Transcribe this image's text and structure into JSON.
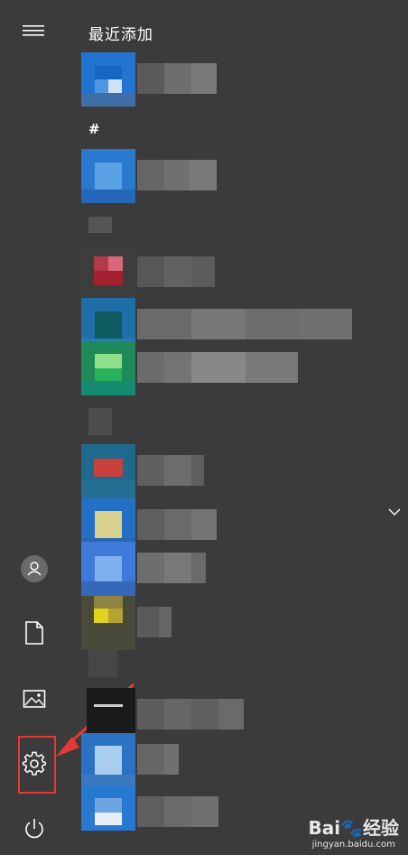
{
  "start_menu": {
    "recently_added_heading": "最近添加",
    "section_hash": "#",
    "expand_icon": "chevron-down-icon"
  },
  "sidebar": {
    "items": [
      {
        "icon": "hamburger-menu-icon"
      },
      {
        "icon": "user-avatar-icon"
      },
      {
        "icon": "documents-icon"
      },
      {
        "icon": "pictures-icon"
      },
      {
        "icon": "settings-gear-icon"
      },
      {
        "icon": "power-icon"
      }
    ]
  },
  "annotation": {
    "highlight_color": "#e53935"
  },
  "watermark": {
    "brand": "Bai",
    "brand_cn": "经验",
    "url": "jingyan.baidu.com"
  },
  "colors": {
    "background": "#3b3b3b",
    "tile_blue": "#1e6fcf"
  }
}
